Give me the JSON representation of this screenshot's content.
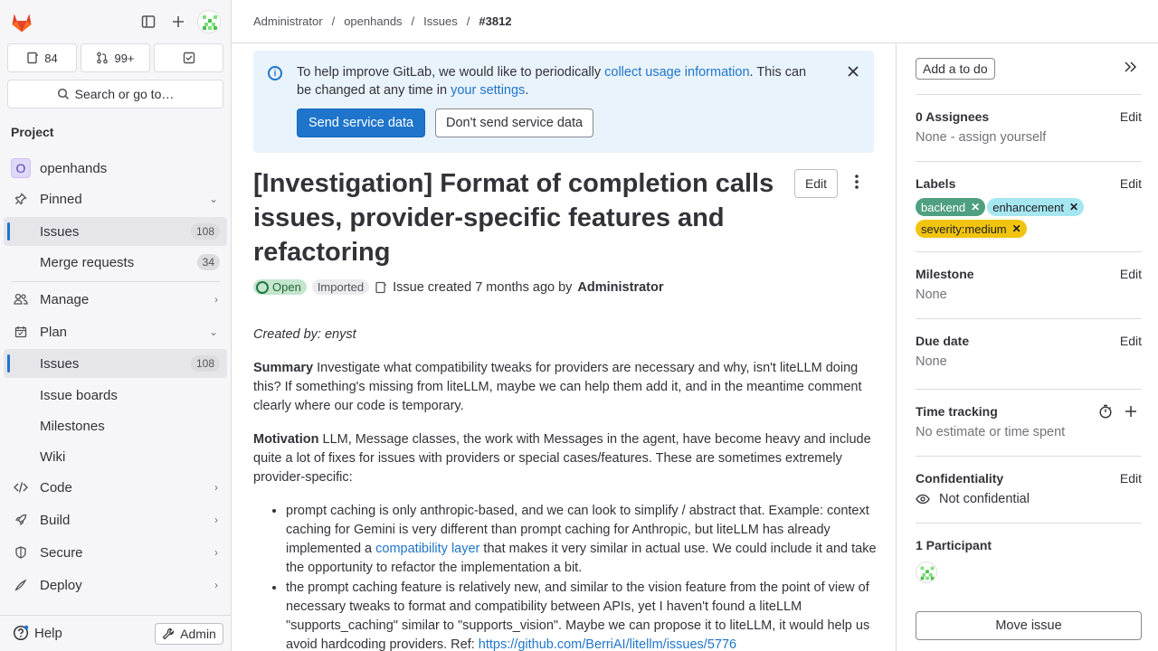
{
  "sidebar": {
    "issues_count": "84",
    "mr_count": "99+",
    "search_label": "Search or go to…",
    "section_title": "Project",
    "project_name": "openhands",
    "project_initial": "O",
    "pinned_label": "Pinned",
    "pinned_issues_label": "Issues",
    "pinned_issues_count": "108",
    "pinned_mr_label": "Merge requests",
    "pinned_mr_count": "34",
    "manage_label": "Manage",
    "plan_label": "Plan",
    "plan_issues_label": "Issues",
    "plan_issues_count": "108",
    "issue_boards_label": "Issue boards",
    "milestones_label": "Milestones",
    "wiki_label": "Wiki",
    "code_label": "Code",
    "build_label": "Build",
    "secure_label": "Secure",
    "deploy_label": "Deploy",
    "help_label": "Help",
    "admin_label": "Admin"
  },
  "breadcrumb": {
    "items": [
      "Administrator",
      "openhands",
      "Issues"
    ],
    "current": "#3812",
    "separator": "/"
  },
  "banner": {
    "text_before": "To help improve GitLab, we would like to periodically ",
    "link1": "collect usage information",
    "text_middle": ". This can be changed at any time in ",
    "link2": "your settings",
    "text_after": ".",
    "primary_button": "Send service data",
    "secondary_button": "Don't send service data"
  },
  "issue": {
    "title": "[Investigation] Format of completion calls issues, provider-specific features and refactoring",
    "edit_label": "Edit",
    "status": "Open",
    "imported": "Imported",
    "created_text": "Issue created 7 months ago by",
    "author": "Administrator",
    "created_by": "Created by: enyst",
    "summary_label": "Summary",
    "summary_text": " Investigate what compatibility tweaks for providers are necessary and why, isn't liteLLM doing this? If something's missing from liteLLM, maybe we can help them add it, and in the meantime comment clearly where our code is temporary.",
    "motivation_label": "Motivation",
    "motivation_text": " LLM, Message classes, the work with Messages in the agent, have become heavy and include quite a lot of fixes for issues with providers or special cases/features. These are sometimes extremely provider-specific:",
    "bullet1_before": "prompt caching is only anthropic-based, and we can look to simplify / abstract that. Example: context caching for Gemini is very different than prompt caching for Anthropic, but liteLLM has already implemented a ",
    "bullet1_link": "compatibility layer",
    "bullet1_after": " that makes it very similar in actual use. We could include it and take the opportunity to refactor the implementation a bit.",
    "bullet2_before": "the prompt caching feature is relatively new, and similar to the vision feature from the point of view of necessary tweaks to format and compatibility between APIs, yet I haven't found a liteLLM \"supports_caching\" similar to \"supports_vision\". Maybe we can propose it to liteLLM, it would help us avoid hardcoding providers. Ref: ",
    "bullet2_link": "https://github.com/BerriAI/litellm/issues/5776"
  },
  "right_panel": {
    "todo_button": "Add a to do",
    "assignees_title": "0 Assignees",
    "assignees_value": "None - assign yourself",
    "labels_title": "Labels",
    "labels": [
      {
        "name": "backend",
        "bg": "#4fa081",
        "fg": "#ffffff"
      },
      {
        "name": "enhancement",
        "bg": "#a5e6f0",
        "fg": "#1f1e24"
      },
      {
        "name": "severity:medium",
        "bg": "#f1c40f",
        "fg": "#1f1e24"
      }
    ],
    "milestone_title": "Milestone",
    "milestone_value": "None",
    "due_title": "Due date",
    "due_value": "None",
    "time_title": "Time tracking",
    "time_value": "No estimate or time spent",
    "conf_title": "Confidentiality",
    "conf_value": "Not confidential",
    "participants_title": "1 Participant",
    "edit_label": "Edit",
    "move_button": "Move issue"
  },
  "colors": {
    "accent": "#1f75cb",
    "open_badge": "#c3e6cd",
    "banner_bg": "#e9f3fc"
  }
}
